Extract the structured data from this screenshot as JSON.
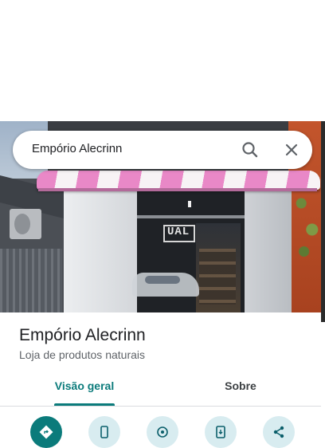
{
  "search": {
    "query": "Empório Alecrinn",
    "search_icon": "search-icon",
    "close_icon": "close-icon"
  },
  "photo": {
    "store_sign_text": "UAL"
  },
  "place": {
    "name": "Empório Alecrinn",
    "category": "Loja de produtos naturais"
  },
  "tabs": [
    {
      "label": "Visão geral",
      "selected": true
    },
    {
      "label": "Sobre",
      "selected": false
    }
  ],
  "actions": [
    {
      "icon": "directions-icon"
    },
    {
      "icon": "phone-icon"
    },
    {
      "icon": "nearby-icon"
    },
    {
      "icon": "send-to-phone-icon"
    },
    {
      "icon": "share-icon"
    }
  ],
  "colors": {
    "accent": "#0b7b7b",
    "action_background": "#d8ecf0",
    "awning_pink": "#e988c7"
  }
}
